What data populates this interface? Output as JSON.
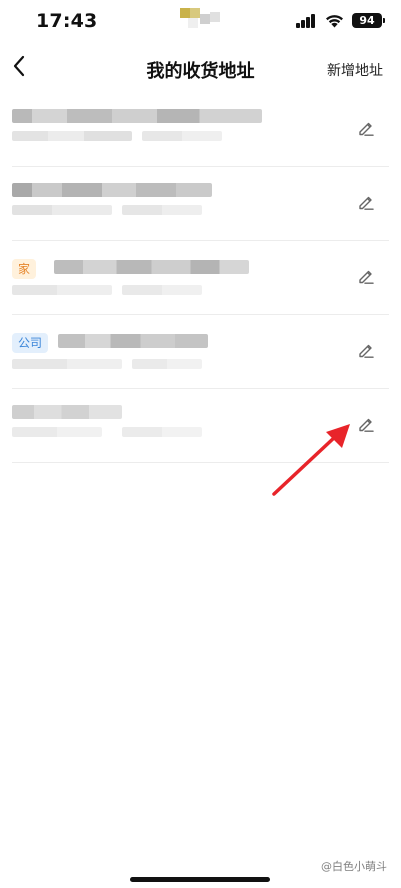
{
  "status_bar": {
    "time": "17:43",
    "battery": "94"
  },
  "nav": {
    "title": "我的收货地址",
    "action_label": "新增地址"
  },
  "addresses": [
    {
      "tag": ""
    },
    {
      "tag": ""
    },
    {
      "tag": "家",
      "tag_color": "#e6852a"
    },
    {
      "tag": "公司",
      "tag_color": "#3b86d9"
    },
    {
      "tag": ""
    }
  ],
  "annotation": {
    "color": "#e8242a"
  },
  "watermark": "@白色小萌斗"
}
